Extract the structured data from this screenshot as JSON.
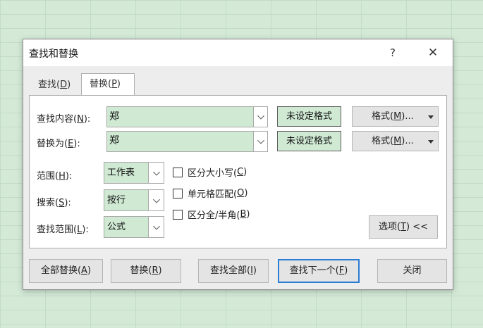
{
  "dialog": {
    "title": "查找和替换",
    "help": "?",
    "close": "✕"
  },
  "tabs": [
    {
      "label": "查找(",
      "key": "D",
      "suffix": ")",
      "selected": false
    },
    {
      "label": "替换(",
      "key": "P",
      "suffix": ")",
      "selected": true
    }
  ],
  "find": {
    "label": "查找内容(",
    "key": "N",
    "suffix": "):",
    "value": "郑",
    "preview": "未设定格式",
    "format_label": "格式(",
    "format_key": "M",
    "format_suffix": ")..."
  },
  "replace": {
    "label": "替换为(",
    "key": "E",
    "suffix": "):",
    "value": "郑",
    "preview": "未设定格式",
    "format_label": "格式(",
    "format_key": "M",
    "format_suffix": ")..."
  },
  "options": {
    "within": {
      "label": "范围(",
      "key": "H",
      "suffix": "):",
      "value": "工作表"
    },
    "search": {
      "label": "搜索(",
      "key": "S",
      "suffix": "):",
      "value": "按行"
    },
    "look_in": {
      "label": "查找范围(",
      "key": "L",
      "suffix": "):",
      "value": "公式"
    }
  },
  "checkboxes": [
    {
      "label": "区分大小写(",
      "key": "C",
      "suffix": ")",
      "checked": false
    },
    {
      "label": "单元格匹配(",
      "key": "O",
      "suffix": ")",
      "checked": false
    },
    {
      "label": "区分全/半角(",
      "key": "B",
      "suffix": ")",
      "checked": false
    }
  ],
  "options_button": {
    "label": "选项(",
    "key": "T",
    "suffix": ") <<"
  },
  "buttons": {
    "replace_all": {
      "label": "全部替换(",
      "key": "A",
      "suffix": ")"
    },
    "replace": {
      "label": "替换(",
      "key": "R",
      "suffix": ")"
    },
    "find_all": {
      "label": "查找全部(",
      "key": "I",
      "suffix": ")"
    },
    "find_next": {
      "label": "查找下一个(",
      "key": "F",
      "suffix": ")"
    },
    "close": {
      "label": "关闭"
    }
  }
}
